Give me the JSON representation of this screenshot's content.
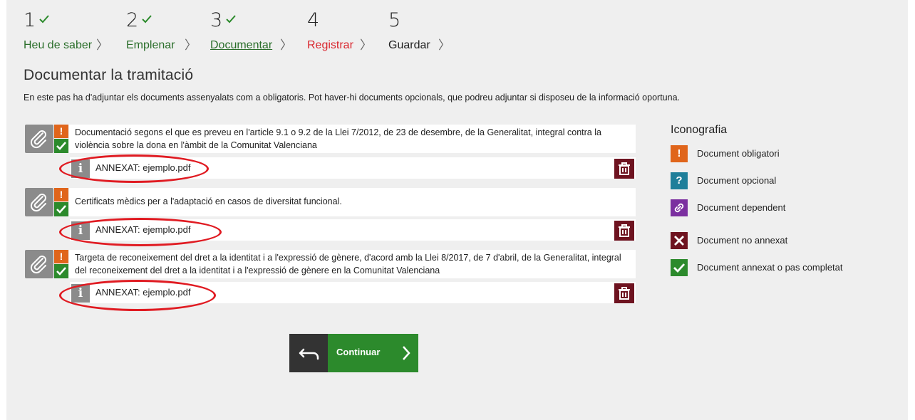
{
  "steps": [
    {
      "num": "1",
      "label": "Heu de saber",
      "state": "done"
    },
    {
      "num": "2",
      "label": "Emplenar",
      "state": "done"
    },
    {
      "num": "3",
      "label": "Documentar",
      "state": "current"
    },
    {
      "num": "4",
      "label": "Registrar",
      "state": "active"
    },
    {
      "num": "5",
      "label": "Guardar",
      "state": "pending"
    }
  ],
  "page": {
    "title": "Documentar la tramitació",
    "intro": "En este pas ha d'adjuntar els documents assenyalats com a obligatoris. Pot haver-hi documents opcionals, que podreu adjuntar si disposeu de la informació oportuna."
  },
  "documents": [
    {
      "description": "Documentació segons el que es preveu en l'article 9.1 o 9.2 de la Llei 7/2012, de 23 de desembre, de la Generalitat, integral contra la violència sobre la dona en l'àmbit de la Comunitat Valenciana",
      "attachment": "ANNEXAT: ejemplo.pdf",
      "required_mark": "!"
    },
    {
      "description": "Certificats mèdics per a l'adaptació en casos de diversitat funcional.",
      "attachment": "ANNEXAT: ejemplo.pdf",
      "required_mark": "!"
    },
    {
      "description": "Targeta de reconeixement del dret a la identitat i a l'expressió de gènere, d'acord amb la Llei 8/2017, de 7 d'abril, de la Generalitat, integral del reconeixement del dret a la identitat i a l'expressió de gènere en la Comunitat Valenciana",
      "attachment": "ANNEXAT: ejemplo.pdf",
      "required_mark": "!"
    }
  ],
  "legend": {
    "title": "Iconografia",
    "items": [
      {
        "icon": "exclamation-icon",
        "label": "Document obligatori",
        "color": "#e0651b",
        "glyph": "!"
      },
      {
        "icon": "question-icon",
        "label": "Document opcional",
        "color": "#1f7f9a",
        "glyph": "?"
      },
      {
        "icon": "link-icon",
        "label": "Document dependent",
        "color": "#7b2fa0",
        "glyph": ""
      },
      {
        "icon": "cross-icon",
        "label": "Document no annexat",
        "color": "#6e1320",
        "glyph": ""
      },
      {
        "icon": "check-icon",
        "label": "Document annexat o pas completat",
        "color": "#2c8a2c",
        "glyph": ""
      }
    ]
  },
  "actions": {
    "continue_label": "Continuar"
  },
  "colors": {
    "green": "#2c8a2c",
    "red_active": "#d9262e",
    "orange": "#e0651b",
    "trash": "#6e1320",
    "annotation_oval": "#e01b22"
  }
}
